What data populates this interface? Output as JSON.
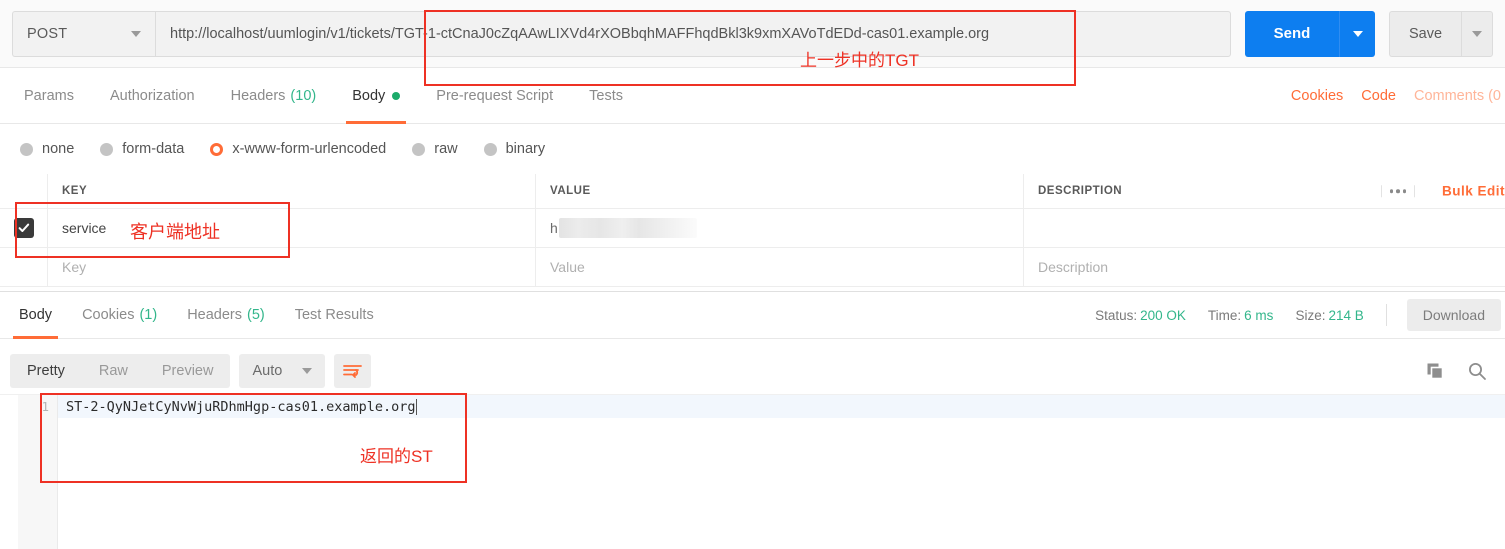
{
  "request": {
    "method": "POST",
    "url": "http://localhost/uumlogin/v1/tickets/TGT-1-ctCnaJ0cZqAAwLIXVd4rXOBbqhMAFFhqdBkl3k9xmXAVoTdEDd-cas01.example.org",
    "send_label": "Send",
    "save_label": "Save"
  },
  "request_tabs": [
    {
      "label": "Params",
      "count": "",
      "active": false
    },
    {
      "label": "Authorization",
      "count": "",
      "active": false
    },
    {
      "label": "Headers",
      "count": "(10)",
      "active": false
    },
    {
      "label": "Body",
      "count": "",
      "active": true,
      "dot": true
    },
    {
      "label": "Pre-request Script",
      "count": "",
      "active": false
    },
    {
      "label": "Tests",
      "count": "",
      "active": false
    }
  ],
  "request_tabs_right": {
    "cookies": "Cookies",
    "code": "Code",
    "comments": "Comments (0"
  },
  "body_types": [
    {
      "label": "none",
      "checked": false
    },
    {
      "label": "form-data",
      "checked": false
    },
    {
      "label": "x-www-form-urlencoded",
      "checked": true
    },
    {
      "label": "raw",
      "checked": false
    },
    {
      "label": "binary",
      "checked": false
    }
  ],
  "kv_table": {
    "headers": {
      "key": "KEY",
      "value": "VALUE",
      "description": "DESCRIPTION"
    },
    "bulk_edit": "Bulk Edit",
    "rows": [
      {
        "checked": true,
        "key": "service",
        "value_redacted_prefix": "h",
        "description": ""
      }
    ],
    "placeholder_row": {
      "key": "Key",
      "value": "Value",
      "description": "Description"
    }
  },
  "response_tabs": [
    {
      "label": "Body",
      "count": "",
      "active": true
    },
    {
      "label": "Cookies",
      "count": "(1)",
      "active": false
    },
    {
      "label": "Headers",
      "count": "(5)",
      "active": false
    },
    {
      "label": "Test Results",
      "count": "",
      "active": false
    }
  ],
  "response_meta": {
    "status_label": "Status:",
    "status_value": "200 OK",
    "time_label": "Time:",
    "time_value": "6 ms",
    "size_label": "Size:",
    "size_value": "214 B",
    "download_label": "Download"
  },
  "response_toolbar": {
    "views": [
      {
        "label": "Pretty",
        "active": true
      },
      {
        "label": "Raw",
        "active": false
      },
      {
        "label": "Preview",
        "active": false
      }
    ],
    "format": "Auto"
  },
  "response_body": {
    "line_number": "1",
    "text": "ST-2-QyNJetCyNvWjuRDhmHgp-cas01.example.org"
  },
  "annotations": [
    {
      "id": "tgt",
      "text": "上一步中的TGT"
    },
    {
      "id": "service",
      "text": "客户端地址"
    },
    {
      "id": "st",
      "text": "返回的ST"
    }
  ],
  "colors": {
    "accent_orange": "#ff6c37",
    "send_blue": "#0d7ef0",
    "status_green": "#33b68b",
    "annotation_red": "#ee3124"
  }
}
